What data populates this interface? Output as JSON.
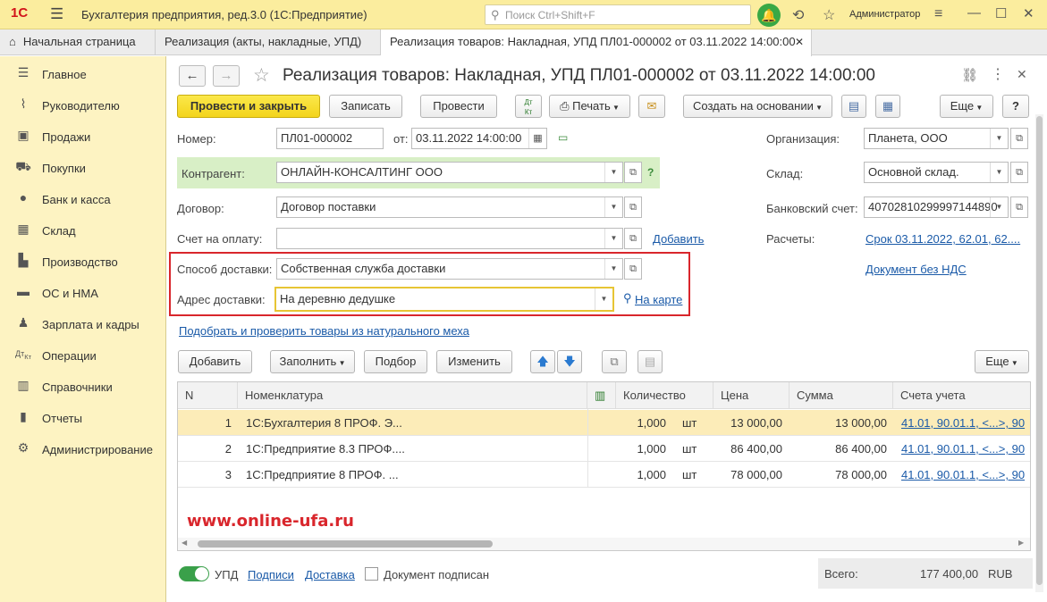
{
  "topbar": {
    "logo": "1С",
    "app_title": "Бухгалтерия предприятия, ред.3.0  (1С:Предприятие)",
    "search_placeholder": "Поиск Ctrl+Shift+F",
    "user": "Администратор"
  },
  "tabs": [
    {
      "label": "Начальная страница"
    },
    {
      "label": "Реализация (акты, накладные, УПД)"
    },
    {
      "label": "Реализация товаров: Накладная, УПД ПЛ01-000002 от 03.11.2022 14:00:00"
    }
  ],
  "sidebar": {
    "items": [
      {
        "label": "Главное",
        "icon": "menu-icon"
      },
      {
        "label": "Руководителю",
        "icon": "chart-line-icon"
      },
      {
        "label": "Продажи",
        "icon": "bag-icon"
      },
      {
        "label": "Покупки",
        "icon": "cart-icon"
      },
      {
        "label": "Банк и касса",
        "icon": "ruble-coin-icon"
      },
      {
        "label": "Склад",
        "icon": "warehouse-icon"
      },
      {
        "label": "Производство",
        "icon": "factory-icon"
      },
      {
        "label": "ОС и НМА",
        "icon": "truck-icon"
      },
      {
        "label": "Зарплата и кадры",
        "icon": "person-icon"
      },
      {
        "label": "Операции",
        "icon": "dt-kt-icon"
      },
      {
        "label": "Справочники",
        "icon": "book-icon"
      },
      {
        "label": "Отчеты",
        "icon": "bar-chart-icon"
      },
      {
        "label": "Администрирование",
        "icon": "gear-icon"
      }
    ]
  },
  "document": {
    "title": "Реализация товаров: Накладная, УПД ПЛ01-000002 от 03.11.2022 14:00:00"
  },
  "toolbar": {
    "post_close": "Провести и закрыть",
    "save": "Записать",
    "post": "Провести",
    "dtkt": "Дт Кт",
    "print": "Печать",
    "create_based": "Создать на основании",
    "more": "Еще",
    "help": "?"
  },
  "form": {
    "number_label": "Номер:",
    "number_value": "ПЛ01-000002",
    "date_label": "от:",
    "date_value": "03.11.2022 14:00:00",
    "counterparty_label": "Контрагент:",
    "counterparty_value": "ОНЛАЙН-КОНСАЛТИНГ ООО",
    "contract_label": "Договор:",
    "contract_value": "Договор поставки",
    "invoice_label": "Счет на оплату:",
    "invoice_value": "",
    "add_link": "Добавить",
    "delivery_method_label": "Способ доставки:",
    "delivery_method_value": "Собственная служба доставки",
    "delivery_address_label": "Адрес доставки:",
    "delivery_address_value": "На деревню дедушке",
    "on_map_link": "На карте",
    "org_label": "Организация:",
    "org_value": "Планета, ООО",
    "warehouse_label": "Склад:",
    "warehouse_value": "Основной склад.",
    "bank_label": "Банковский счет:",
    "bank_value": "40702810299997144890",
    "settlements_label": "Расчеты:",
    "settlements_link": "Срок 03.11.2022, 62.01, 62....",
    "vat_link": "Документ без НДС",
    "fur_link": "Подобрать и проверить товары из натурального меха"
  },
  "grid_toolbar": {
    "add": "Добавить",
    "fill": "Заполнить",
    "pick": "Подбор",
    "change": "Изменить",
    "more": "Еще"
  },
  "grid": {
    "headers": [
      "N",
      "Номенклатура",
      "Количество",
      "Цена",
      "Сумма",
      "Счета учета"
    ],
    "rows": [
      {
        "n": "1",
        "name": "1С:Бухгалтерия 8 ПРОФ. Э...",
        "qty": "1,000",
        "unit": "шт",
        "price": "13 000,00",
        "sum": "13 000,00",
        "accounts": "41.01, 90.01.1, <...>, 90"
      },
      {
        "n": "2",
        "name": "1С:Предприятие 8.3 ПРОФ....",
        "qty": "1,000",
        "unit": "шт",
        "price": "86 400,00",
        "sum": "86 400,00",
        "accounts": "41.01, 90.01.1, <...>, 90"
      },
      {
        "n": "3",
        "name": "1С:Предприятие 8 ПРОФ. ...",
        "qty": "1,000",
        "unit": "шт",
        "price": "78 000,00",
        "sum": "78 000,00",
        "accounts": "41.01, 90.01.1, <...>, 90"
      }
    ]
  },
  "watermark": "www.online-ufa.ru",
  "footer": {
    "upd_label": "УПД",
    "signatures_link": "Подписи",
    "delivery_link": "Доставка",
    "signed_label": "Документ подписан",
    "total_label": "Всего:",
    "total_value": "177 400,00",
    "currency": "RUB"
  },
  "colors": {
    "topbar": "#fbed9e",
    "sidebar": "#fdf3c2",
    "highlight_box": "#d9262c",
    "counterparty_bg": "#d8efc6",
    "selected_row": "#fcecb8",
    "link": "#1a5aa8",
    "watermark": "#d9262c"
  }
}
